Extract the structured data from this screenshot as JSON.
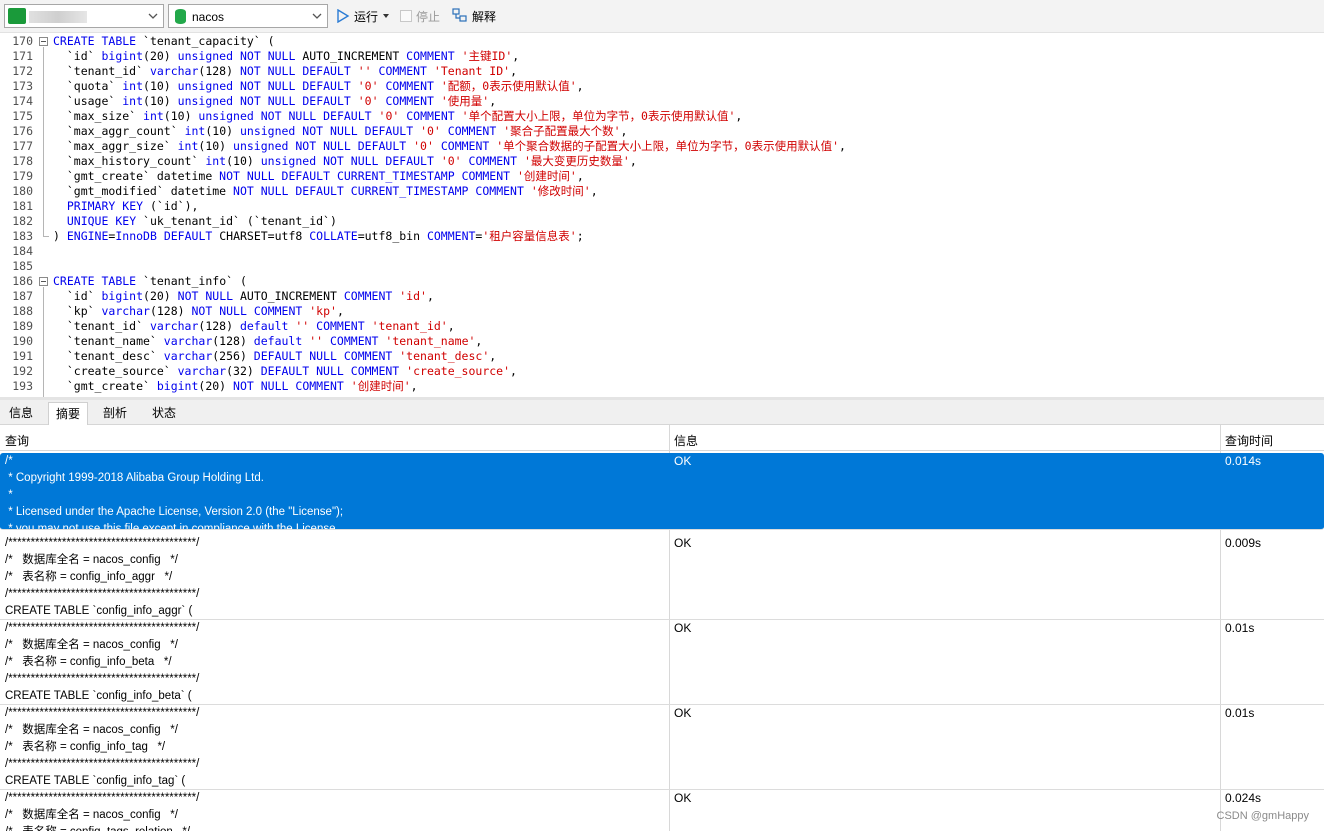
{
  "toolbar": {
    "connection_value": "",
    "database_value": "nacos",
    "run_label": "运行",
    "stop_label": "停止",
    "explain_label": "解释"
  },
  "editor": {
    "lines": [
      {
        "n": "170",
        "html": "<span class=\"kw\">CREATE</span> <span class=\"kw\">TABLE</span> `tenant_capacity` ("
      },
      {
        "n": "171",
        "html": "  `id` <span class=\"kw\">bigint</span>(20) <span class=\"kw\">unsigned</span> <span class=\"kw\">NOT</span> <span class=\"kw\">NULL</span> AUTO_INCREMENT <span class=\"kw\">COMMENT</span> <span class=\"str\">'主键ID'</span>,"
      },
      {
        "n": "172",
        "html": "  `tenant_id` <span class=\"kw\">varchar</span>(128) <span class=\"kw\">NOT</span> <span class=\"kw\">NULL</span> <span class=\"kw\">DEFAULT</span> <span class=\"str\">''</span> <span class=\"kw\">COMMENT</span> <span class=\"str\">'Tenant ID'</span>,"
      },
      {
        "n": "173",
        "html": "  `quota` <span class=\"kw\">int</span>(10) <span class=\"kw\">unsigned</span> <span class=\"kw\">NOT</span> <span class=\"kw\">NULL</span> <span class=\"kw\">DEFAULT</span> <span class=\"str\">'0'</span> <span class=\"kw\">COMMENT</span> <span class=\"str\">'配额，0表示使用默认值'</span>,"
      },
      {
        "n": "174",
        "html": "  `usage` <span class=\"kw\">int</span>(10) <span class=\"kw\">unsigned</span> <span class=\"kw\">NOT</span> <span class=\"kw\">NULL</span> <span class=\"kw\">DEFAULT</span> <span class=\"str\">'0'</span> <span class=\"kw\">COMMENT</span> <span class=\"str\">'使用量'</span>,"
      },
      {
        "n": "175",
        "html": "  `max_size` <span class=\"kw\">int</span>(10) <span class=\"kw\">unsigned</span> <span class=\"kw\">NOT</span> <span class=\"kw\">NULL</span> <span class=\"kw\">DEFAULT</span> <span class=\"str\">'0'</span> <span class=\"kw\">COMMENT</span> <span class=\"str\">'单个配置大小上限，单位为字节，0表示使用默认值'</span>,"
      },
      {
        "n": "176",
        "html": "  `max_aggr_count` <span class=\"kw\">int</span>(10) <span class=\"kw\">unsigned</span> <span class=\"kw\">NOT</span> <span class=\"kw\">NULL</span> <span class=\"kw\">DEFAULT</span> <span class=\"str\">'0'</span> <span class=\"kw\">COMMENT</span> <span class=\"str\">'聚合子配置最大个数'</span>,"
      },
      {
        "n": "177",
        "html": "  `max_aggr_size` <span class=\"kw\">int</span>(10) <span class=\"kw\">unsigned</span> <span class=\"kw\">NOT</span> <span class=\"kw\">NULL</span> <span class=\"kw\">DEFAULT</span> <span class=\"str\">'0'</span> <span class=\"kw\">COMMENT</span> <span class=\"str\">'单个聚合数据的子配置大小上限，单位为字节，0表示使用默认值'</span>,"
      },
      {
        "n": "178",
        "html": "  `max_history_count` <span class=\"kw\">int</span>(10) <span class=\"kw\">unsigned</span> <span class=\"kw\">NOT</span> <span class=\"kw\">NULL</span> <span class=\"kw\">DEFAULT</span> <span class=\"str\">'0'</span> <span class=\"kw\">COMMENT</span> <span class=\"str\">'最大变更历史数量'</span>,"
      },
      {
        "n": "179",
        "html": "  `gmt_create` datetime <span class=\"kw\">NOT</span> <span class=\"kw\">NULL</span> <span class=\"kw\">DEFAULT</span> <span class=\"kw\">CURRENT_TIMESTAMP</span> <span class=\"kw\">COMMENT</span> <span class=\"str\">'创建时间'</span>,"
      },
      {
        "n": "180",
        "html": "  `gmt_modified` datetime <span class=\"kw\">NOT</span> <span class=\"kw\">NULL</span> <span class=\"kw\">DEFAULT</span> <span class=\"kw\">CURRENT_TIMESTAMP</span> <span class=\"kw\">COMMENT</span> <span class=\"str\">'修改时间'</span>,"
      },
      {
        "n": "181",
        "html": "  <span class=\"kw\">PRIMARY</span> <span class=\"kw\">KEY</span> (`id`),"
      },
      {
        "n": "182",
        "html": "  <span class=\"kw\">UNIQUE</span> <span class=\"kw\">KEY</span> `uk_tenant_id` (`tenant_id`)"
      },
      {
        "n": "183",
        "html": ") <span class=\"kw\">ENGINE</span>=<span class=\"kw\">InnoDB</span> <span class=\"kw\">DEFAULT</span> CHARSET=utf8 <span class=\"kw\">COLLATE</span>=utf8_bin <span class=\"kw\">COMMENT</span>=<span class=\"str\">'租户容量信息表'</span>;"
      },
      {
        "n": "184",
        "html": ""
      },
      {
        "n": "185",
        "html": ""
      },
      {
        "n": "186",
        "html": "<span class=\"kw\">CREATE</span> <span class=\"kw\">TABLE</span> `tenant_info` ("
      },
      {
        "n": "187",
        "html": "  `id` <span class=\"kw\">bigint</span>(20) <span class=\"kw\">NOT</span> <span class=\"kw\">NULL</span> AUTO_INCREMENT <span class=\"kw\">COMMENT</span> <span class=\"str\">'id'</span>,"
      },
      {
        "n": "188",
        "html": "  `kp` <span class=\"kw\">varchar</span>(128) <span class=\"kw\">NOT</span> <span class=\"kw\">NULL</span> <span class=\"kw\">COMMENT</span> <span class=\"str\">'kp'</span>,"
      },
      {
        "n": "189",
        "html": "  `tenant_id` <span class=\"kw\">varchar</span>(128) <span class=\"kw\">default</span> <span class=\"str\">''</span> <span class=\"kw\">COMMENT</span> <span class=\"str\">'tenant_id'</span>,"
      },
      {
        "n": "190",
        "html": "  `tenant_name` <span class=\"kw\">varchar</span>(128) <span class=\"kw\">default</span> <span class=\"str\">''</span> <span class=\"kw\">COMMENT</span> <span class=\"str\">'tenant_name'</span>,"
      },
      {
        "n": "191",
        "html": "  `tenant_desc` <span class=\"kw\">varchar</span>(256) <span class=\"kw\">DEFAULT</span> <span class=\"kw\">NULL</span> <span class=\"kw\">COMMENT</span> <span class=\"str\">'tenant_desc'</span>,"
      },
      {
        "n": "192",
        "html": "  `create_source` <span class=\"kw\">varchar</span>(32) <span class=\"kw\">DEFAULT</span> <span class=\"kw\">NULL</span> <span class=\"kw\">COMMENT</span> <span class=\"str\">'create_source'</span>,"
      },
      {
        "n": "193",
        "html": "  `gmt_create` <span class=\"kw\">bigint</span>(20) <span class=\"kw\">NOT</span> <span class=\"kw\">NULL</span> <span class=\"kw\">COMMENT</span> <span class=\"str\">'创建时间'</span>,"
      }
    ]
  },
  "tabs": [
    {
      "label": "信息",
      "active": false
    },
    {
      "label": "摘要",
      "active": true
    },
    {
      "label": "剖析",
      "active": false
    },
    {
      "label": "状态",
      "active": false
    }
  ],
  "grid": {
    "headers": {
      "query": "查询",
      "info": "信息",
      "time": "查询时间"
    },
    "rows": [
      {
        "query": "/*\n * Copyright 1999-2018 Alibaba Group Holding Ltd.\n *\n * Licensed under the Apache License, Version 2.0 (the \"License\");\n * you may not use this file except in compliance with the License.",
        "info": "OK",
        "time": "0.014s",
        "selected": true
      },
      {
        "query": "/******************************************/\n/*   数据库全名 = nacos_config   */\n/*   表名称 = config_info_aggr   */\n/******************************************/\nCREATE TABLE `config_info_aggr` (",
        "info": "OK",
        "time": "0.009s",
        "selected": false
      },
      {
        "query": "/******************************************/\n/*   数据库全名 = nacos_config   */\n/*   表名称 = config_info_beta   */\n/******************************************/\nCREATE TABLE `config_info_beta` (",
        "info": "OK",
        "time": "0.01s",
        "selected": false
      },
      {
        "query": "/******************************************/\n/*   数据库全名 = nacos_config   */\n/*   表名称 = config_info_tag   */\n/******************************************/\nCREATE TABLE `config_info_tag` (",
        "info": "OK",
        "time": "0.01s",
        "selected": false
      },
      {
        "query": "/******************************************/\n/*   数据库全名 = nacos_config   */\n/*   表名称 = config_tags_relation   */",
        "info": "OK",
        "time": "0.024s",
        "selected": false
      }
    ]
  },
  "watermark": "CSDN @gmHappy"
}
